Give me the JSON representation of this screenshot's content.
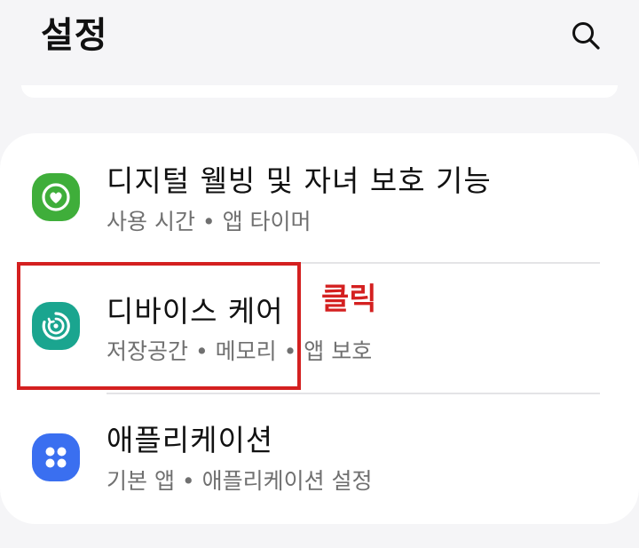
{
  "header": {
    "title": "설정",
    "search_icon": "search-icon"
  },
  "settings": {
    "items": [
      {
        "title": "디지털 웰빙 및 자녀 보호 기능",
        "subtitle": "사용 시간 • 앱 타이머",
        "icon": "digital-wellbeing-icon",
        "icon_color": "#3fae3a"
      },
      {
        "title": "디바이스 케어",
        "subtitle": "저장공간 • 메모리 • 앱 보호",
        "icon": "device-care-icon",
        "icon_color": "#1aa58f"
      },
      {
        "title": "애플리케이션",
        "subtitle": "기본 앱 • 애플리케이션 설정",
        "icon": "apps-icon",
        "icon_color": "#3a6ff0"
      }
    ]
  },
  "annotation": {
    "label": "클릭",
    "color": "#d42020"
  }
}
